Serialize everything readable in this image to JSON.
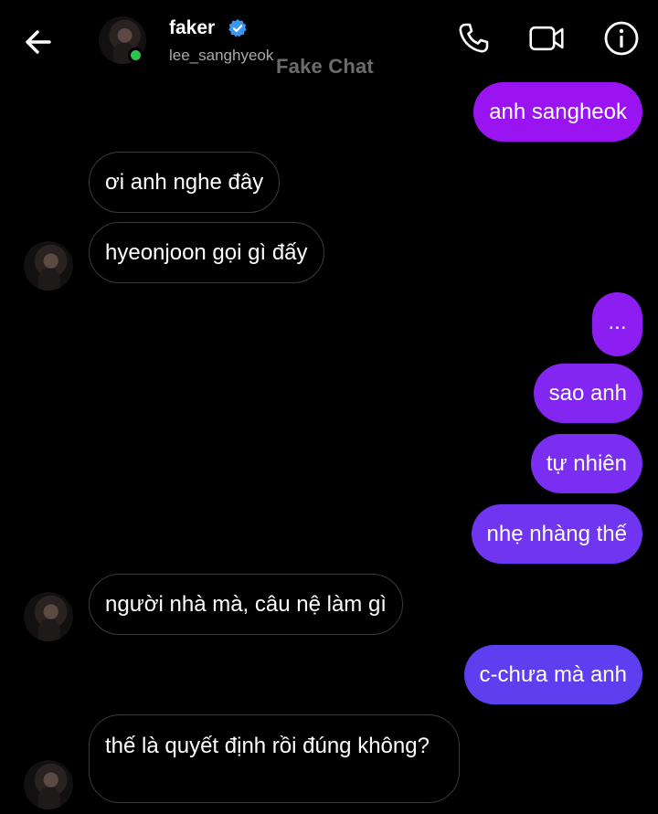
{
  "header": {
    "name": "faker",
    "username": "lee_sanghyeok",
    "watermark": "Fake Chat"
  },
  "colors": {
    "out_top": "#9b16f2",
    "out_bottom": "#5b40f0",
    "online": "#27c64a",
    "verified": "#3897f0"
  },
  "icons": [
    "back-arrow-icon",
    "verified-badge-icon",
    "phone-icon",
    "video-camera-icon",
    "info-icon"
  ],
  "messages": [
    {
      "from": "me",
      "text": "anh sangheok"
    },
    {
      "from": "them",
      "text": "ơi anh nghe đây"
    },
    {
      "from": "them",
      "text": "hyeonjoon gọi gì đấy"
    },
    {
      "from": "me",
      "text": "..."
    },
    {
      "from": "me",
      "text": "sao anh"
    },
    {
      "from": "me",
      "text": "tự nhiên"
    },
    {
      "from": "me",
      "text": "nhẹ nhàng thế"
    },
    {
      "from": "them",
      "text": "người nhà mà, câu nệ làm gì"
    },
    {
      "from": "me",
      "text": "c-chưa mà anh"
    },
    {
      "from": "them",
      "text": "thế là quyết định rồi đúng không?"
    }
  ]
}
